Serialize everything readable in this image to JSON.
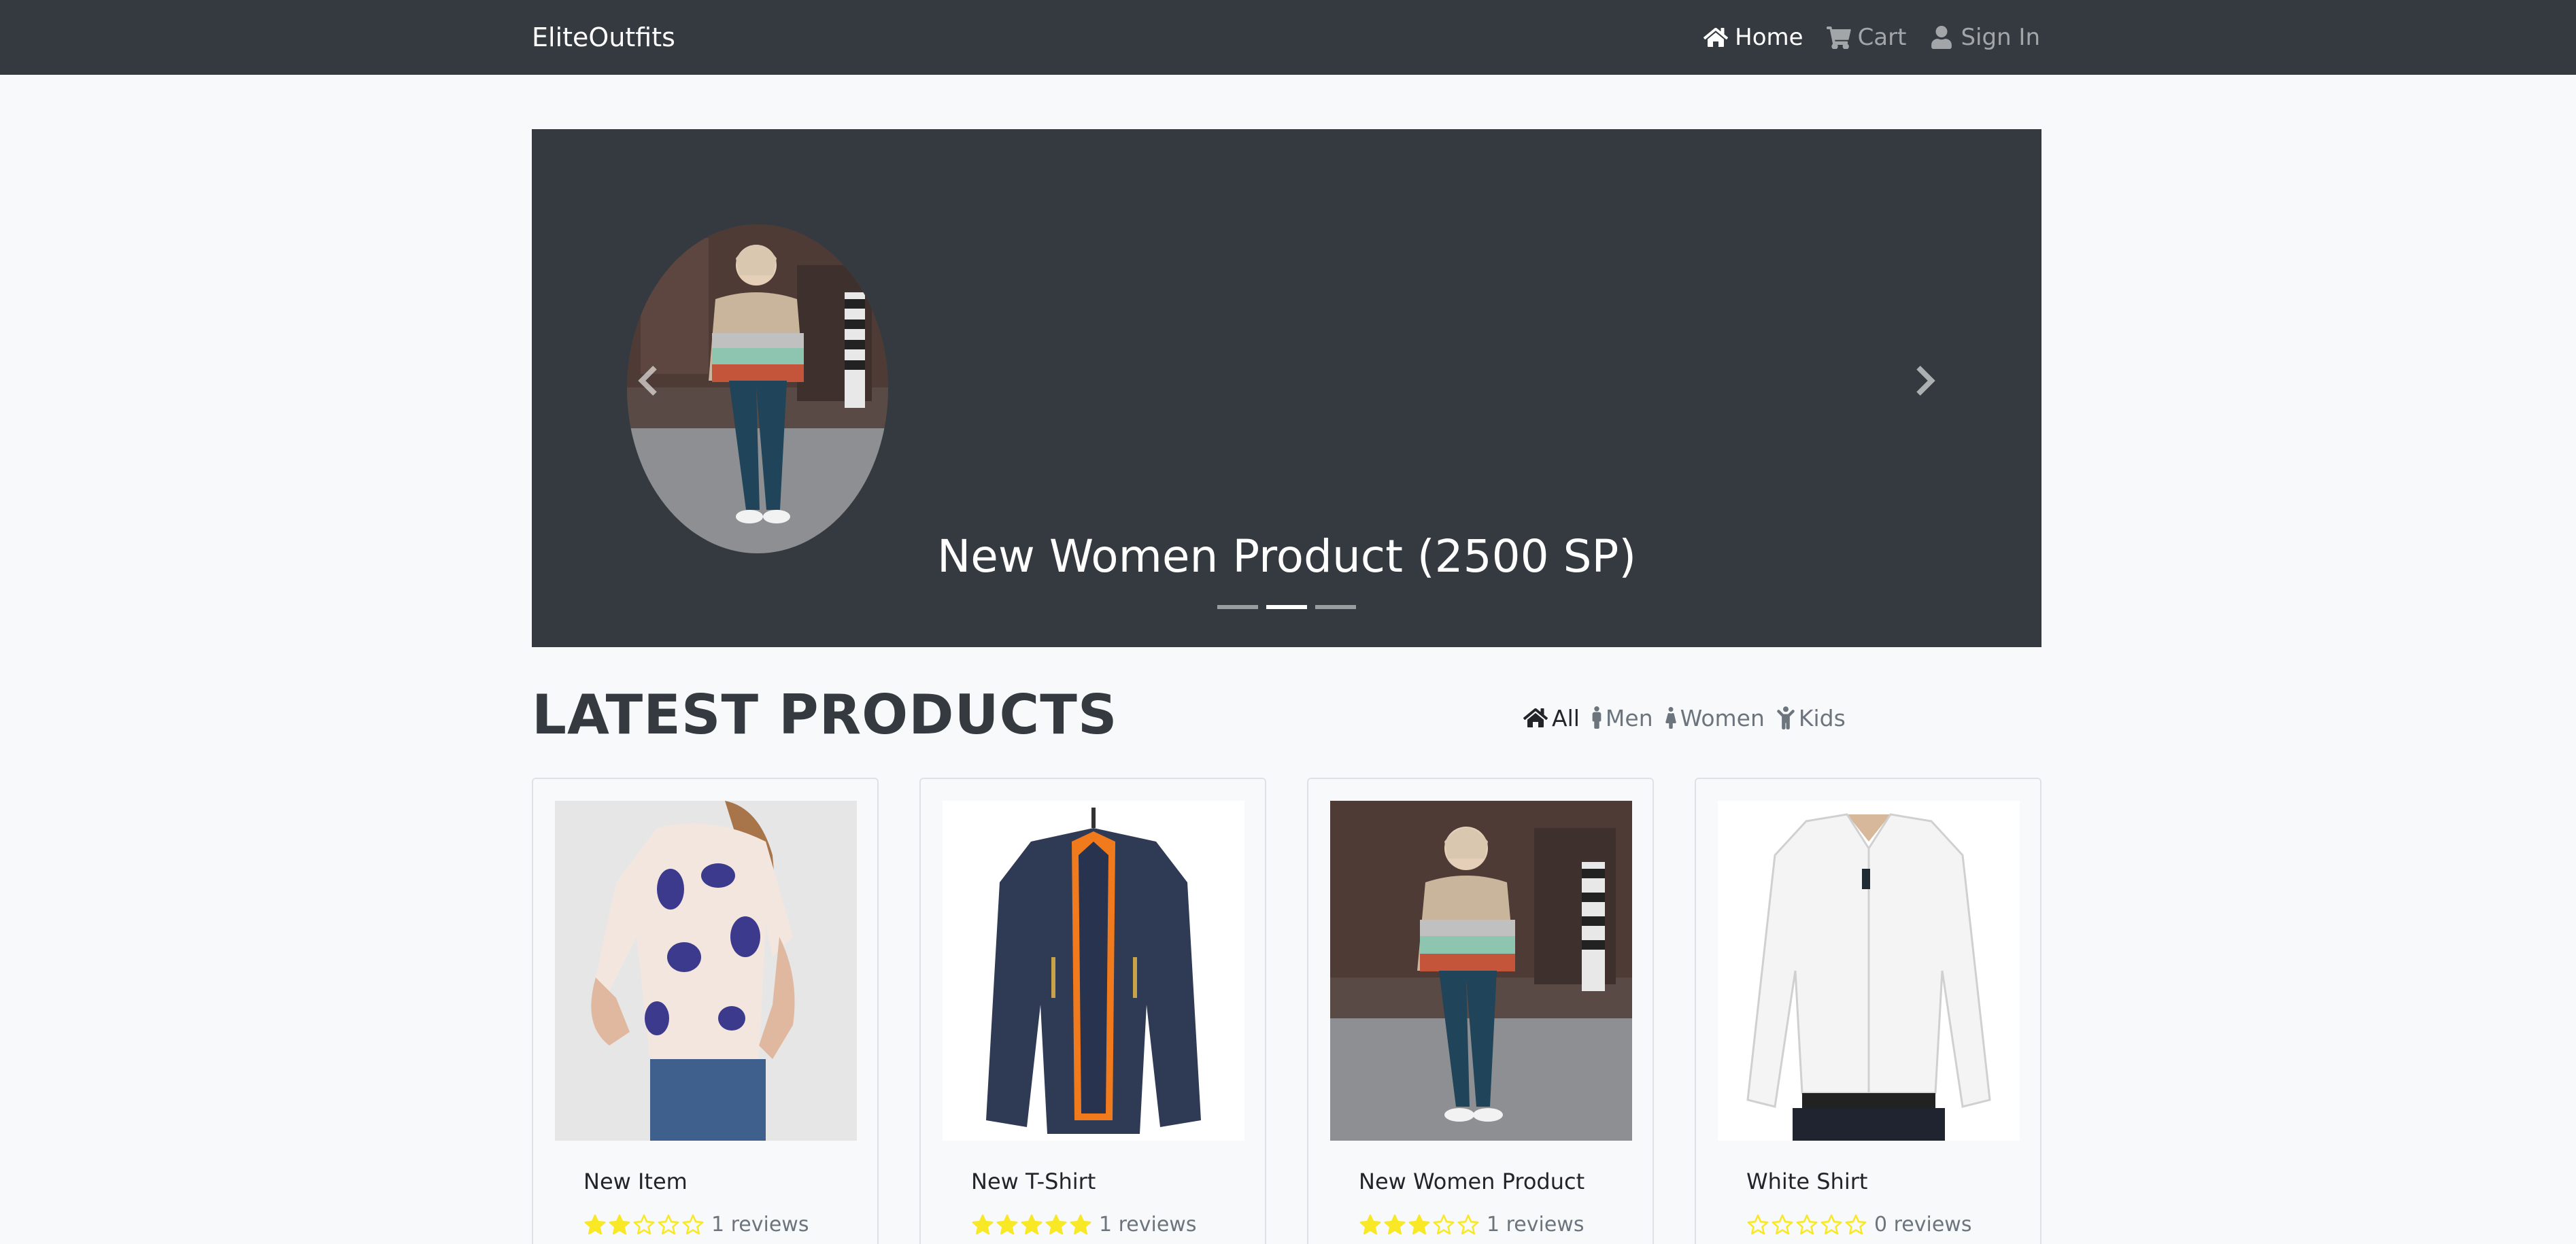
{
  "navbar": {
    "brand": "EliteOutfits",
    "links": [
      {
        "label": "Home",
        "icon": "home-icon",
        "active": true
      },
      {
        "label": "Cart",
        "icon": "cart-icon",
        "active": false
      },
      {
        "label": "Sign In",
        "icon": "user-icon",
        "active": false
      }
    ]
  },
  "carousel": {
    "caption": "New Women Product (2500 SP)",
    "active_index": 1,
    "indicator_count": 3
  },
  "products_section": {
    "title": "LATEST PRODUCTS",
    "filters": [
      {
        "label": "All",
        "icon": "home-icon",
        "active": true
      },
      {
        "label": "Men",
        "icon": "male-icon",
        "active": false
      },
      {
        "label": "Women",
        "icon": "female-icon",
        "active": false
      },
      {
        "label": "Kids",
        "icon": "child-icon",
        "active": false
      }
    ]
  },
  "products": [
    {
      "name": "New Item",
      "rating": 2,
      "reviews": "1 reviews"
    },
    {
      "name": "New T-Shirt",
      "rating": 5,
      "reviews": "1 reviews"
    },
    {
      "name": "New Women Product",
      "rating": 3,
      "reviews": "1 reviews"
    },
    {
      "name": "White Shirt",
      "rating": 0,
      "reviews": "0 reviews"
    }
  ],
  "colors": {
    "navbar_bg": "#343a40",
    "page_bg": "#f8f9fa",
    "star": "#f8e825"
  }
}
